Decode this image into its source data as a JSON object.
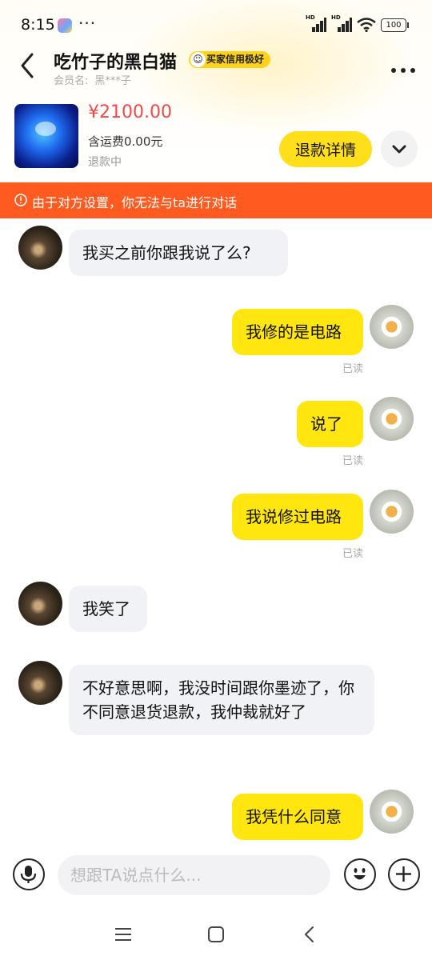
{
  "status_bar": {
    "time": "8:15",
    "more": "···",
    "signal1_label": "HD",
    "signal2_label": "HD",
    "battery": "100",
    "icons": [
      "app-icon",
      "signal-icon",
      "signal-icon",
      "wifi-icon",
      "battery-icon"
    ]
  },
  "header": {
    "title": "吃竹子的黑白猫",
    "credit_badge": "买家信用极好",
    "member_label": "会员名:",
    "member_name": "黑***子",
    "more_icon": "more-icon",
    "back_icon": "chevron-left-icon"
  },
  "order": {
    "price": "¥2100.00",
    "shipping": "含运费0.00元",
    "status": "退款中",
    "refund_button": "退款详情",
    "expand_icon": "chevron-down-icon"
  },
  "notice": {
    "icon": "alert-circle-icon",
    "text": "由于对方设置，你无法与ta进行对话"
  },
  "messages": [
    {
      "from": "them",
      "text": "我买之前你跟我说了么?"
    },
    {
      "from": "me",
      "text": "我修的是电路",
      "status": "已读"
    },
    {
      "from": "me",
      "text": "说了",
      "status": "已读"
    },
    {
      "from": "me",
      "text": "我说修过电路",
      "status": "已读"
    },
    {
      "from": "them",
      "text": "我笑了"
    },
    {
      "from": "them",
      "text": "不好意思啊，我没时间跟你墨迹了，你不同意退货退款，我仲裁就好了"
    },
    {
      "from": "me",
      "text": "我凭什么同意"
    }
  ],
  "input": {
    "placeholder": "想跟TA说点什么...",
    "voice_icon": "microphone-icon",
    "emoji_icon": "emoji-icon",
    "plus_icon": "plus-icon"
  },
  "nav": {
    "icons": [
      "menu-icon",
      "home-icon",
      "back-icon"
    ]
  },
  "colors": {
    "accent_yellow": "#ffde1a",
    "bubble_me": "#ffe60f",
    "bubble_them": "#f1f2f6",
    "notice_bg": "#ff5b21",
    "price": "#f24848"
  }
}
